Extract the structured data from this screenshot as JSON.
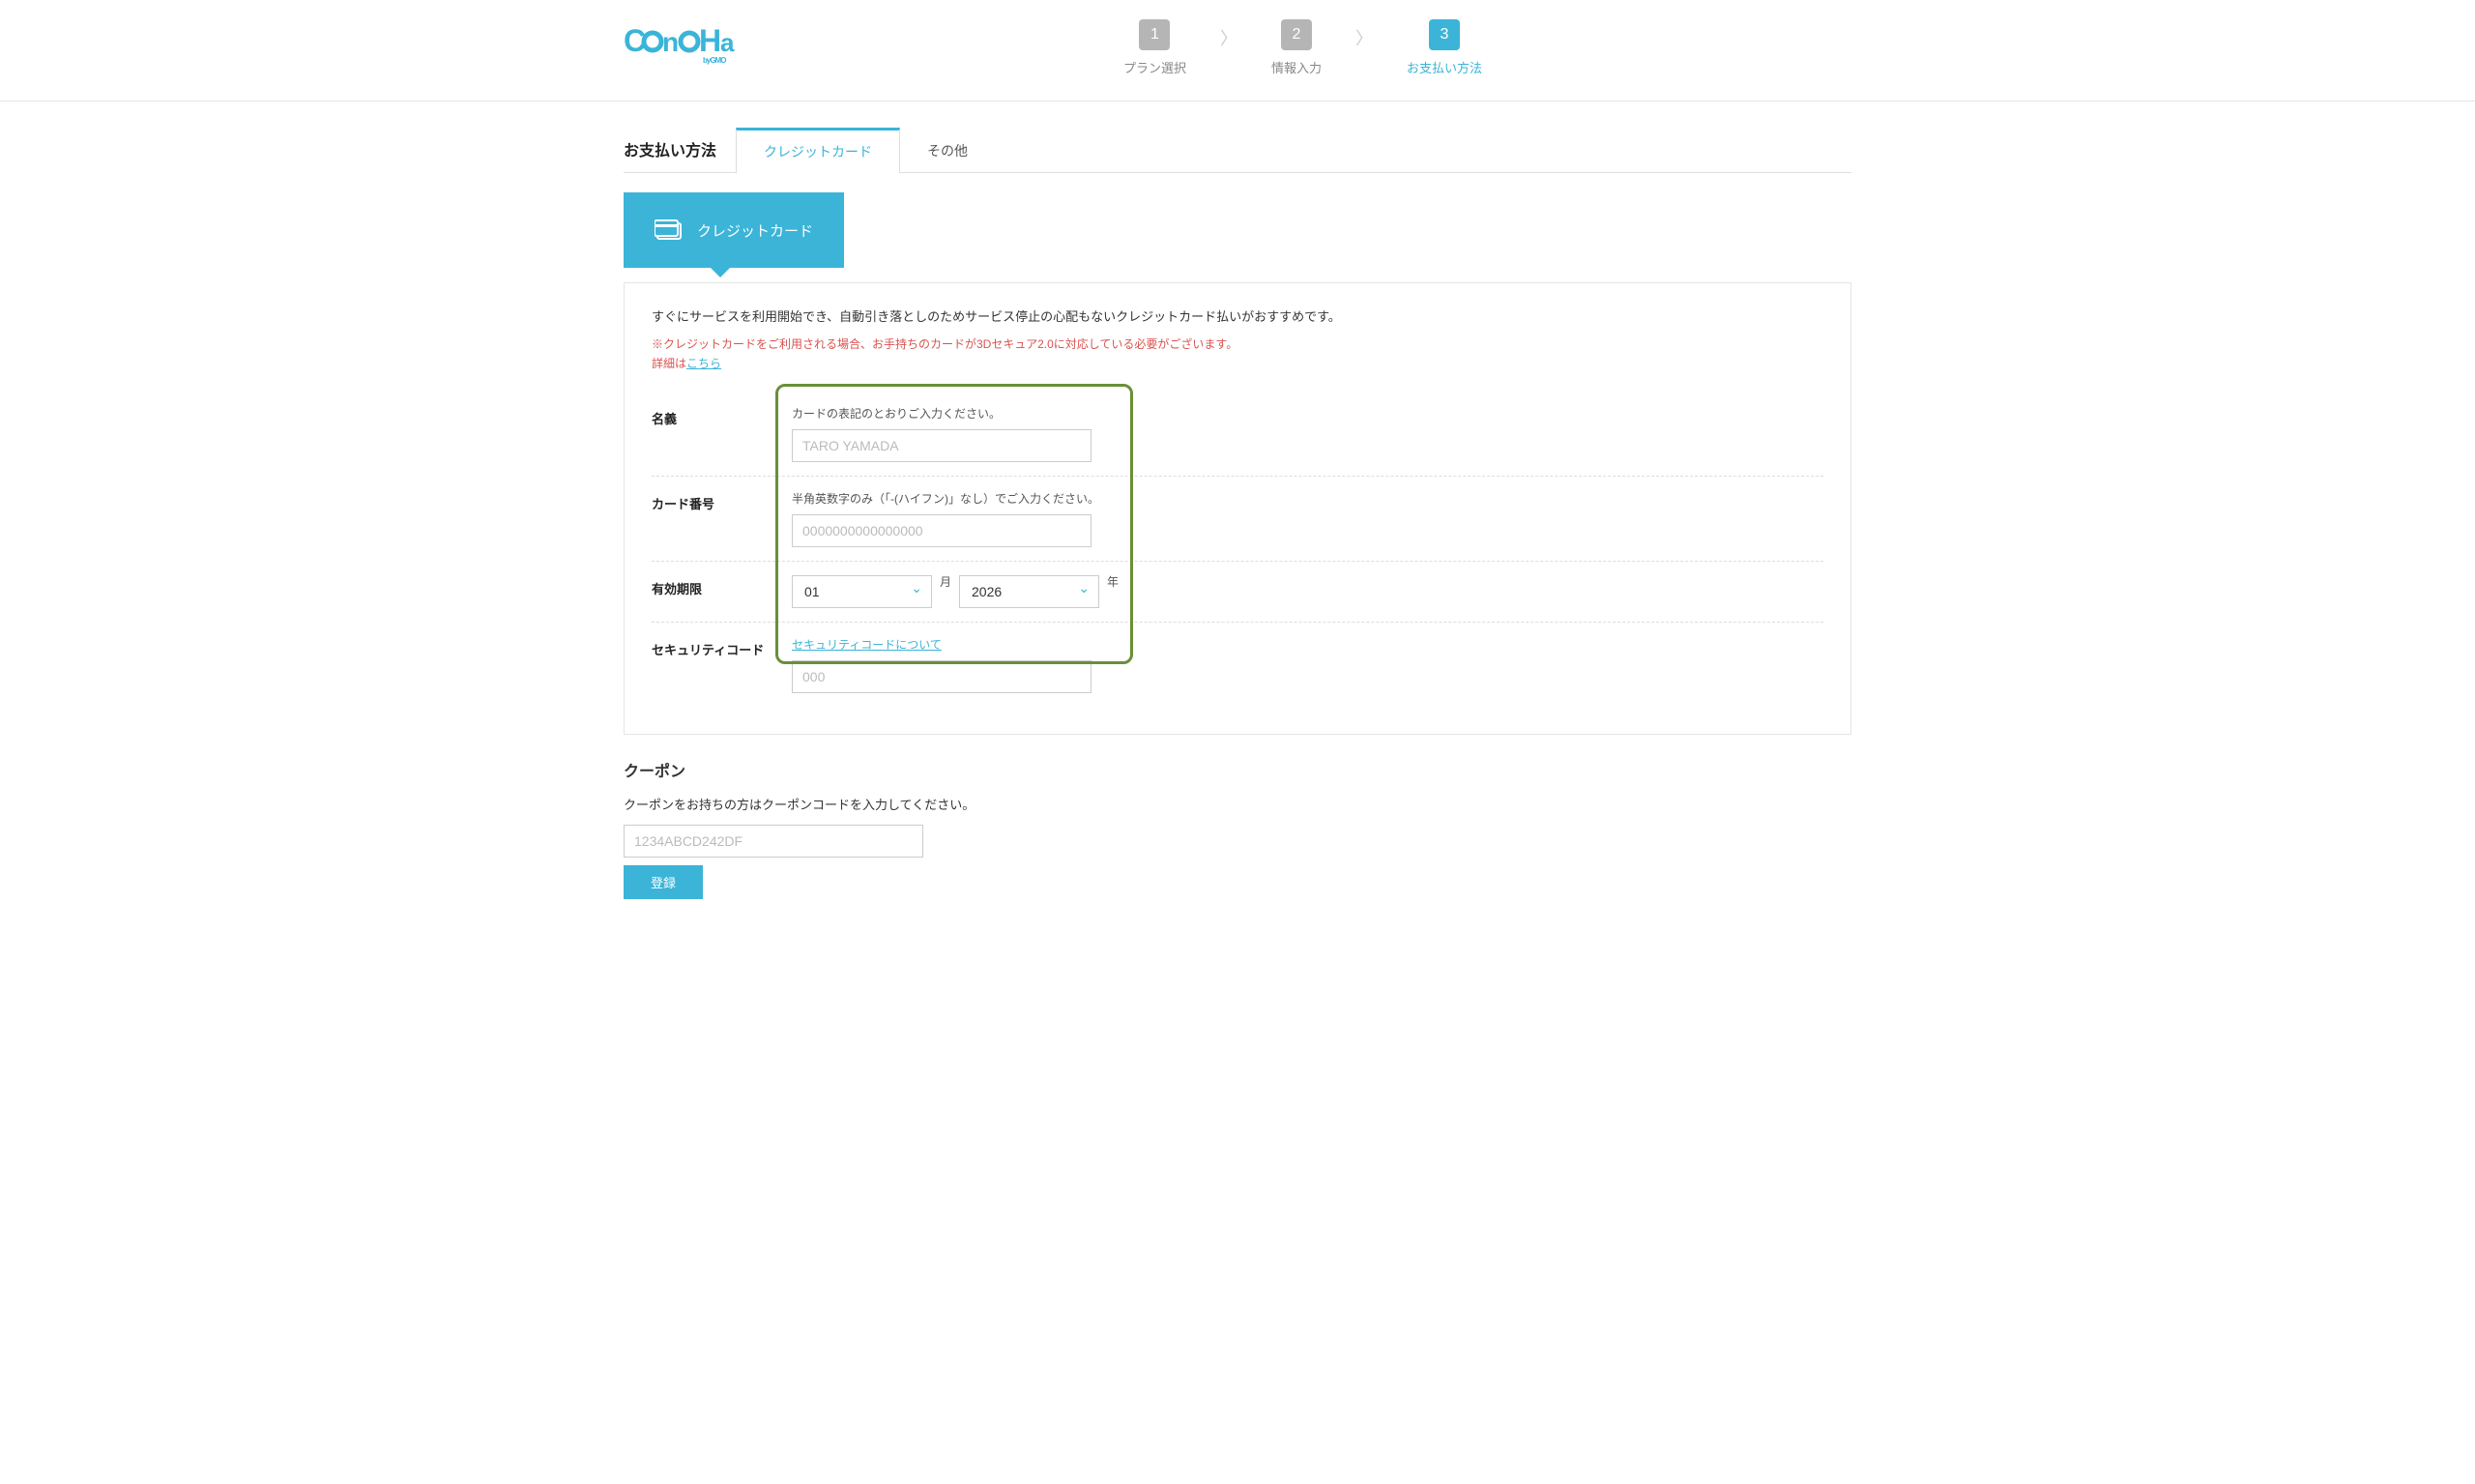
{
  "logo_text": "ConoHa",
  "logo_sub": "byGMO",
  "steps": [
    {
      "num": "1",
      "label": "プラン選択"
    },
    {
      "num": "2",
      "label": "情報入力"
    },
    {
      "num": "3",
      "label": "お支払い方法"
    }
  ],
  "section_title": "お支払い方法",
  "tabs": {
    "credit": "クレジットカード",
    "other": "その他"
  },
  "card_type_label": "クレジットカード",
  "intro_text": "すぐにサービスを利用開始でき、自動引き落としのためサービス停止の心配もないクレジットカード払いがおすすめです。",
  "warn_text": "※クレジットカードをご利用される場合、お手持ちのカードが3Dセキュア2.0に対応している必要がございます。",
  "warn_prefix": "詳細は",
  "warn_link": "こちら",
  "form": {
    "name": {
      "label": "名義",
      "hint": "カードの表記のとおりご入力ください。",
      "placeholder": "TARO YAMADA"
    },
    "number": {
      "label": "カード番号",
      "hint": "半角英数字のみ（「-(ハイフン)」なし）でご入力ください。",
      "placeholder": "0000000000000000"
    },
    "expiry": {
      "label": "有効期限",
      "month_value": "01",
      "month_unit": "月",
      "year_value": "2026",
      "year_unit": "年"
    },
    "cvc": {
      "label": "セキュリティコード",
      "link": "セキュリティコードについて",
      "placeholder": "000"
    }
  },
  "coupon": {
    "title": "クーポン",
    "desc": "クーポンをお持ちの方はクーポンコードを入力してください。",
    "placeholder": "1234ABCD242DF",
    "button": "登録"
  }
}
